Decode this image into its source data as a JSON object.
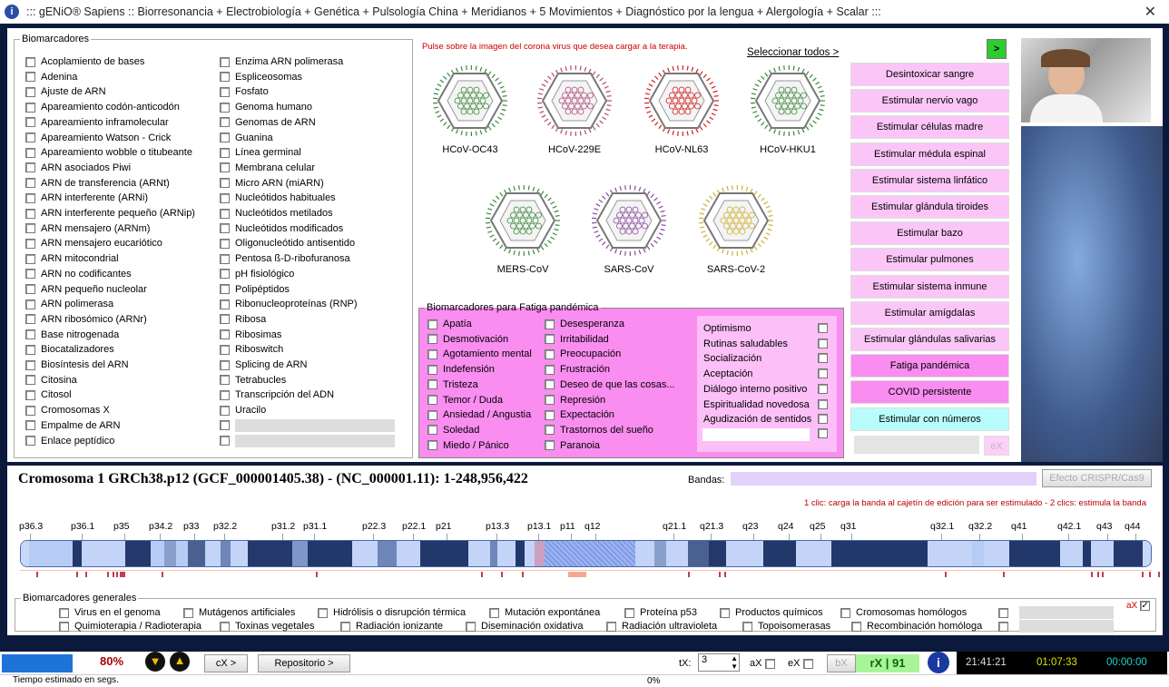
{
  "title": "::: gENiO® Sapiens :: Biorresonancia + Electrobiología + Genética + Pulsología China + Meridianos + 5 Movimientos + Diagnóstico por la lengua + Alergología + Scalar :::",
  "biomarcadores": {
    "legend": "Biomarcadores",
    "col1": [
      "Acoplamiento de bases",
      "Adenina",
      "Ajuste de ARN",
      "Apareamiento codón-anticodón",
      "Apareamiento inframolecular",
      "Apareamiento Watson - Crick",
      "Apareamiento wobble o titubeante",
      "ARN asociados Piwi",
      "ARN de transferencia (ARNt)",
      "ARN interferente (ARNi)",
      "ARN interferente pequeño (ARNip)",
      "ARN mensajero (ARNm)",
      "ARN mensajero eucariótico",
      "ARN mitocondrial",
      "ARN no codificantes",
      "ARN pequeño nucleolar",
      "ARN polimerasa",
      "ARN ribosómico (ARNr)",
      "Base nitrogenada",
      "Biocatalizadores",
      "Biosíntesis del ARN",
      "Citosina",
      "Citosol",
      "Cromosomas X",
      "Empalme de ARN",
      "Enlace peptídico"
    ],
    "col2": [
      "Enzima ARN polimerasa",
      "Espliceosomas",
      "Fosfato",
      "Genoma humano",
      "Genomas de ARN",
      "Guanina",
      "Línea germinal",
      "Membrana celular",
      "Micro ARN (miARN)",
      "Nucleótidos habituales",
      "Nucleótidos metilados",
      "Nucleótidos modificados",
      "Oligonucleótido antisentido",
      "Pentosa ß-D-ribofuranosa",
      "pH fisiológico",
      "Polipéptidos",
      "Ribonucleoproteínas (RNP)",
      "Ribosa",
      "Ribosimas",
      "Riboswitch",
      "Splicing de ARN",
      "Tetrabucles",
      "Transcripción del ADN",
      "Uracilo"
    ]
  },
  "virus": {
    "instruction": "Pulse sobre la imagen del corona virus que desea cargar a la terapia.",
    "select_all": "Seleccionar todos >",
    "go": ">",
    "items": [
      {
        "name": "HCoV-OC43",
        "color": "#3a8a3a"
      },
      {
        "name": "HCoV-229E",
        "color": "#b04a7a"
      },
      {
        "name": "HCoV-NL63",
        "color": "#d02020"
      },
      {
        "name": "HCoV-HKU1",
        "color": "#3a8a3a"
      },
      {
        "name": "MERS-CoV",
        "color": "#3a8a3a"
      },
      {
        "name": "SARS-CoV",
        "color": "#8a4aa0"
      },
      {
        "name": "SARS-CoV-2",
        "color": "#d0b030"
      }
    ]
  },
  "fatiga": {
    "legend": "Biomarcadores para Fatiga pandémica",
    "col1": [
      "Apatía",
      "Desmotivación",
      "Agotamiento mental",
      "Indefensión",
      "Tristeza",
      "Temor / Duda",
      "Ansiedad / Angustia",
      "Soledad",
      "Miedo / Pánico"
    ],
    "col2": [
      "Desesperanza",
      "Irritabilidad",
      "Preocupación",
      "Frustración",
      "Deseo de que las cosas...",
      "Represión",
      "Expectación",
      "Trastornos del sueño",
      "Paranoia"
    ],
    "positive": [
      "Optimismo",
      "Rutinas saludables",
      "Socialización",
      "Aceptación",
      "Diálogo interno positivo",
      "Espiritualidad novedosa",
      "Agudización de sentidos"
    ]
  },
  "actions": [
    "Desintoxicar sangre",
    "Estimular nervio vago",
    "Estimular células madre",
    "Estimular médula espinal",
    "Estimular sistema linfático",
    "Estimular glándula tiroides",
    "Estimular bazo",
    "Estimular pulmones",
    "Estimular sistema inmune",
    "Estimular amígdalas",
    "Estimular glándulas salivarias",
    "Fatiga pandémica",
    "COVID persistente",
    "Estimular con números"
  ],
  "ex_button": "eX",
  "cromosoma": {
    "title": "Cromosoma 1 GRCh38.p12 (GCF_000001405.38) - (NC_000001.11): 1-248,956,422",
    "bandas_label": "Bandas:",
    "crispr": "Efecto CRISPR/Cas9",
    "hint": "1 clic: carga la banda al cajetín de edición para ser estimulado - 2 clics: estimula la banda",
    "bands": [
      "p36.3",
      "p36.1",
      "p35",
      "p34.2",
      "p33",
      "p32.2",
      "p31.2",
      "p31.1",
      "p22.3",
      "p22.1",
      "p21",
      "p13.3",
      "p13.1",
      "p11",
      "q12",
      "q21.1",
      "q21.3",
      "q23",
      "q24",
      "q25",
      "q31",
      "q32.1",
      "q32.2",
      "q41",
      "q42.1",
      "q43",
      "q44"
    ]
  },
  "generales": {
    "legend": "Biomarcadores generales",
    "row1": [
      "Virus en el genoma",
      "Mutágenos artificiales",
      "Hidrólisis o disrupción térmica",
      "Mutación expontánea",
      "Proteína p53",
      "Productos químicos",
      "Cromosomas homólogos"
    ],
    "row2": [
      "Quimioterapia / Radioterapia",
      "Toxinas vegetales",
      "Radiación ionizante",
      "Diseminación oxidativa",
      "Radiación ultravioleta",
      "Topoisomerasas",
      "Recombinación homóloga"
    ],
    "ax": "aX"
  },
  "status": {
    "percent": "80%",
    "progress": 0.8,
    "cx": "cX >",
    "repositorio": "Repositorio >",
    "tx_label": "tX:",
    "tx_value": "3",
    "ax": "aX",
    "ex": "eX",
    "bx": "bX",
    "rx": "rX | 91",
    "clock1": "21:41:21",
    "clock2": "01:07:33",
    "clock3": "00:00:00",
    "estimado": "Tiempo estimado en segs.",
    "bottom_percent": "0%"
  }
}
